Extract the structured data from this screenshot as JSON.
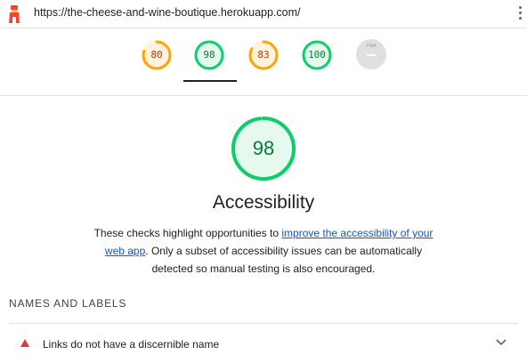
{
  "url_bar": {
    "url": "https://the-cheese-and-wine-boutique.herokuapp.com/"
  },
  "colors": {
    "pass": "#0cce6b",
    "average": "#ffa400",
    "fail": "#e53935",
    "link": "#1155cc"
  },
  "scores": [
    {
      "value": "80",
      "rating": "average"
    },
    {
      "value": "98",
      "rating": "pass",
      "selected": true
    },
    {
      "value": "83",
      "rating": "average"
    },
    {
      "value": "100",
      "rating": "pass"
    }
  ],
  "score_fractions": [
    0.8,
    0.98,
    0.83,
    1.0
  ],
  "pwa": {
    "label": "PWA"
  },
  "category": {
    "score": "98",
    "score_fraction": 0.98,
    "title": "Accessibility",
    "description_before": "These checks highlight opportunities to ",
    "description_link": "improve the accessibility of your web app",
    "description_after": ". Only a subset of accessibility issues can be automatically detected so manual testing is also encouraged."
  },
  "group": {
    "title": "NAMES AND LABELS"
  },
  "audit": {
    "title": "Links do not have a discernible name",
    "icon": "fail-triangle-icon"
  }
}
